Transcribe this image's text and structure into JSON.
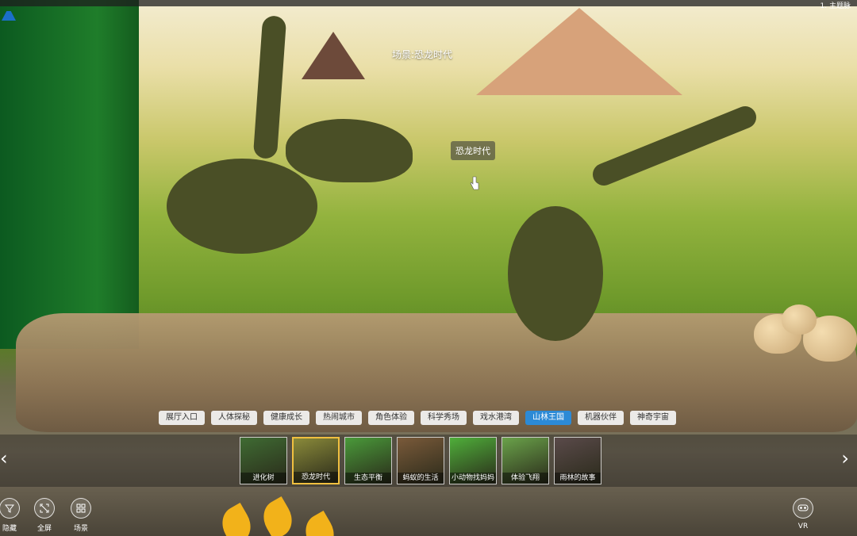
{
  "top": {
    "scene_menu_label": "1. 主题脉"
  },
  "scene": {
    "title_prefix": "场景:",
    "title_name": "恐龙时代",
    "hotspot_label": "恐龙时代"
  },
  "tabs": [
    {
      "label": "展厅入口",
      "active": false
    },
    {
      "label": "人体探秘",
      "active": false
    },
    {
      "label": "健康成长",
      "active": false
    },
    {
      "label": "热闹城市",
      "active": false
    },
    {
      "label": "角色体验",
      "active": false
    },
    {
      "label": "科学秀场",
      "active": false
    },
    {
      "label": "戏水港湾",
      "active": false
    },
    {
      "label": "山林王国",
      "active": true
    },
    {
      "label": "机器伙伴",
      "active": false
    },
    {
      "label": "神奇宇宙",
      "active": false
    }
  ],
  "thumbnails": [
    {
      "caption": "进化树",
      "color": "#3f6b33",
      "active": false
    },
    {
      "caption": "恐龙时代",
      "color": "#8a8a3a",
      "active": true
    },
    {
      "caption": "生态平衡",
      "color": "#4a9a3a",
      "active": false
    },
    {
      "caption": "蚂蚁的生活",
      "color": "#7a5a3a",
      "active": false
    },
    {
      "caption": "小动物找妈妈",
      "color": "#4fae3a",
      "active": false
    },
    {
      "caption": "体验飞翔",
      "color": "#6aa24a",
      "active": false
    },
    {
      "caption": "雨林的故事",
      "color": "#5a4a4a",
      "active": false
    }
  ],
  "toolbar": {
    "hide_label": "隐藏",
    "fullscreen_label": "全屏",
    "scenes_label": "场景",
    "vr_label": "VR"
  },
  "icons": {
    "hide": "funnel-icon",
    "fullscreen": "expand-icon",
    "scenes": "grid-icon",
    "vr": "vr-goggles-icon",
    "prev": "chevron-left-icon",
    "next": "chevron-right-icon"
  },
  "colors": {
    "accent": "#2c8ad6",
    "active_thumb_border": "#f0c040"
  }
}
